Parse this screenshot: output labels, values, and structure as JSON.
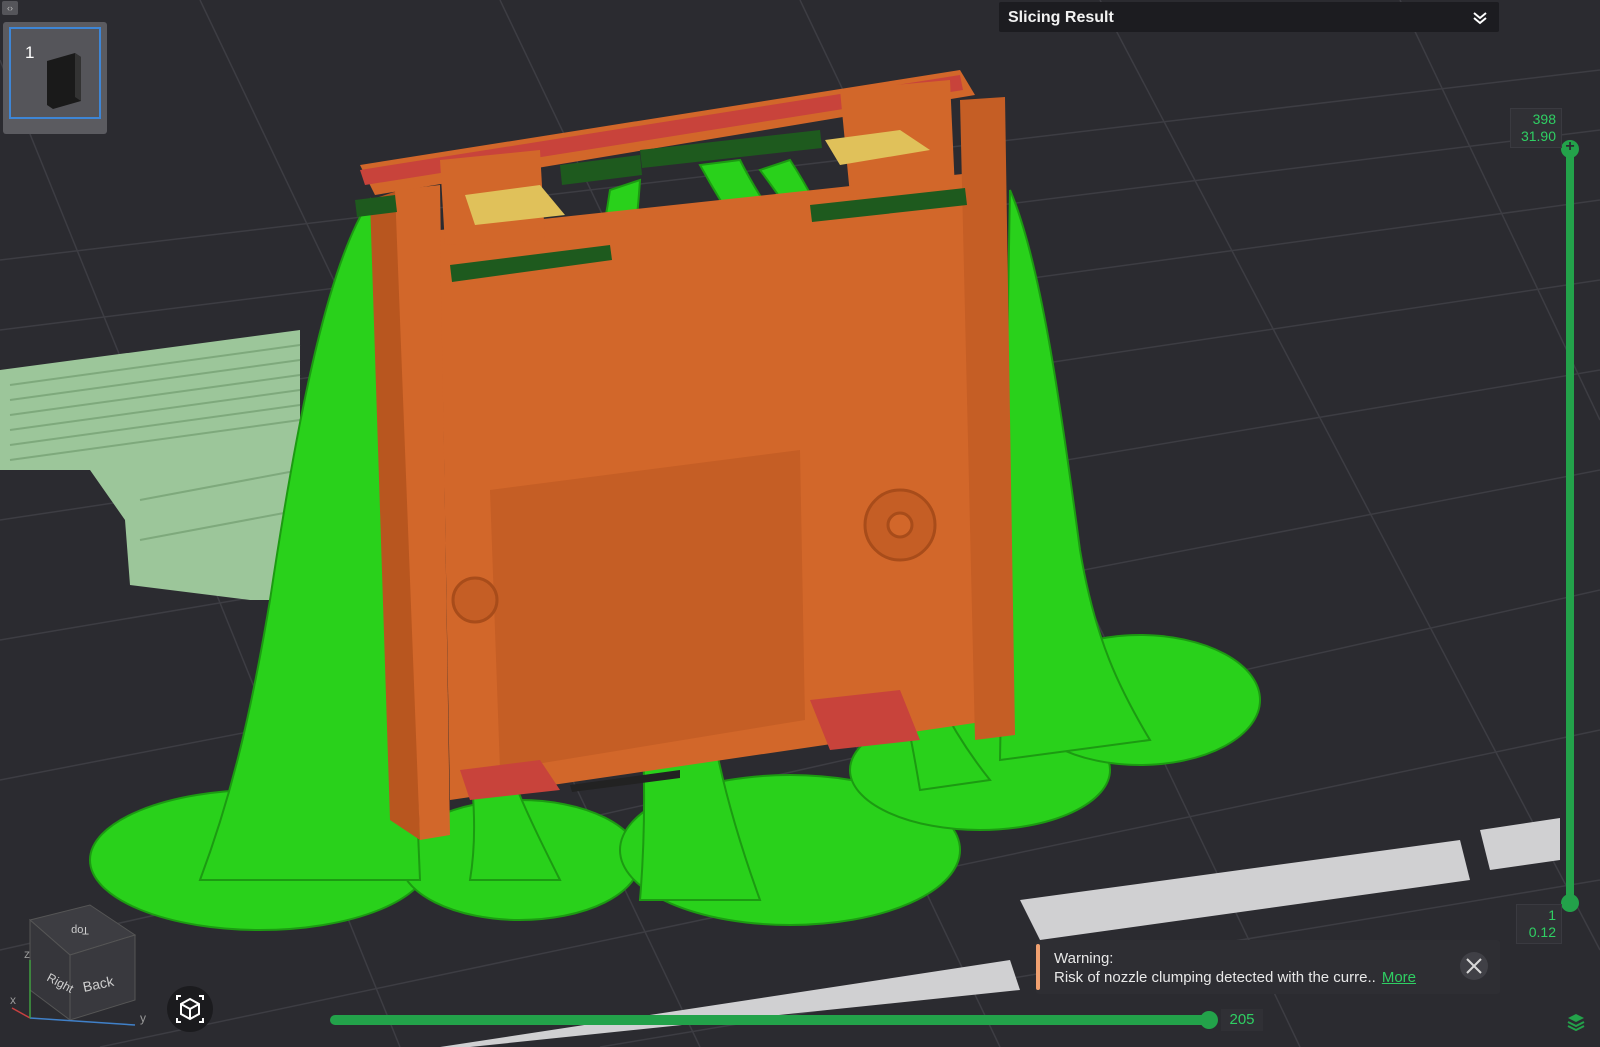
{
  "thumbnail": {
    "plate_number": "1"
  },
  "header": {
    "title": "Slicing Result"
  },
  "layer_slider": {
    "top_layer": "398",
    "top_height": "31.90",
    "bottom_layer": "1",
    "bottom_height": "0.12"
  },
  "move_slider": {
    "value": "205"
  },
  "warning": {
    "title": "Warning:",
    "message": "Risk of nozzle clumping detected with the curre..",
    "link": "More"
  },
  "view_cube": {
    "face_top": "Top",
    "face_right": "Right",
    "face_back": "Back",
    "axis_x": "x",
    "axis_y": "y",
    "axis_z": "z"
  },
  "colors": {
    "support": "#29d11b",
    "model": "#d2672a",
    "accent": "#23a24a",
    "warning_accent": "#f0a070",
    "background": "#2b2b30"
  }
}
